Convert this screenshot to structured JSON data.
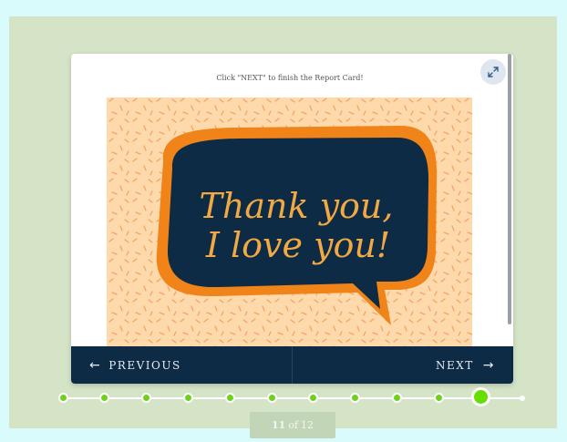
{
  "instruction": "Click \"NEXT\" to finish the Report Card!",
  "expand_button_icon": "expand-icon",
  "artwork": {
    "line1": "Thank you,",
    "line2": "I love you!",
    "colors": {
      "background": "#fdd9ac",
      "bubble": "#0d2b45",
      "accent": "#f08418",
      "text": "#f2a944"
    }
  },
  "nav": {
    "previous_label": "PREVIOUS",
    "next_label": "NEXT",
    "previous_icon": "arrow-left-icon",
    "next_icon": "arrow-right-icon"
  },
  "progress": {
    "total": 12,
    "current": 11
  },
  "page_indicator": {
    "current": "11",
    "separator": "of",
    "total": "12"
  },
  "colors": {
    "accent": "#66df00",
    "nav_bg": "#0d2b45",
    "stage_bg": "#d5e4c6"
  }
}
